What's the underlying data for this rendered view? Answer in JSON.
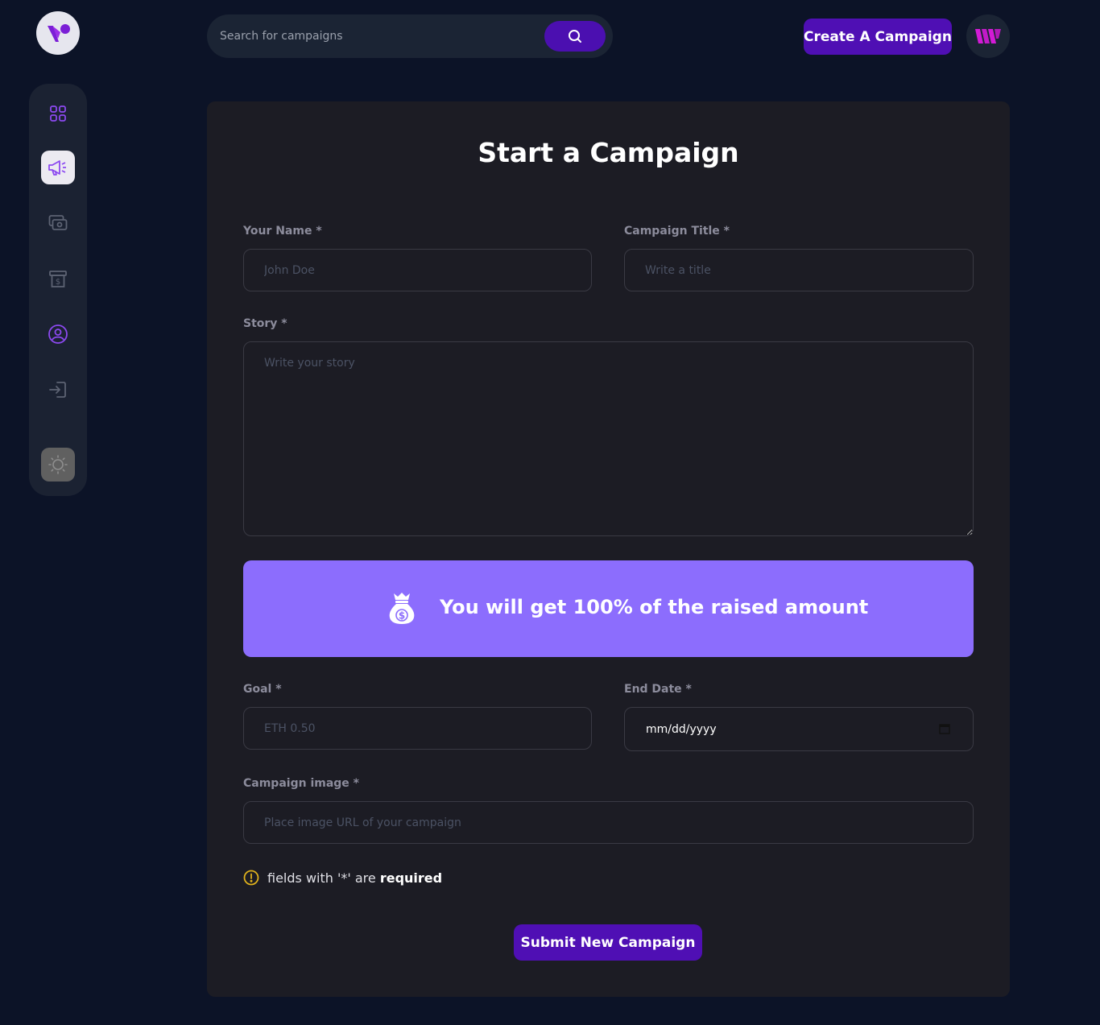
{
  "app": {
    "logo_icon": "v-logo-icon"
  },
  "sidebar": {
    "items": [
      {
        "icon": "dashboard-grid-icon",
        "active": false
      },
      {
        "icon": "megaphone-icon",
        "active": true
      },
      {
        "icon": "payment-icon",
        "active": false
      },
      {
        "icon": "withdraw-icon",
        "active": false
      },
      {
        "icon": "profile-icon",
        "active": false
      },
      {
        "icon": "logout-icon",
        "active": false
      }
    ],
    "theme_toggle_icon": "sun-icon"
  },
  "header": {
    "search_placeholder": "Search for campaigns",
    "search_icon": "search-icon",
    "create_label": "Create A Campaign",
    "avatar_icon": "brand-avatar-icon"
  },
  "form": {
    "title": "Start a Campaign",
    "name_label": "Your Name *",
    "name_placeholder": "John Doe",
    "campaign_title_label": "Campaign Title *",
    "campaign_title_placeholder": "Write a title",
    "story_label": "Story *",
    "story_placeholder": "Write your story",
    "banner_text": "You will get 100% of the raised amount",
    "banner_icon": "money-bag-icon",
    "goal_label": "Goal *",
    "goal_placeholder": "ETH 0.50",
    "end_date_label": "End Date *",
    "end_date_value": "mm/dd/yyyy",
    "image_label": "Campaign image *",
    "image_placeholder": "Place image URL of your campaign",
    "required_note": "fields with '*' are",
    "required_word": "required",
    "submit_label": "Submit New Campaign"
  },
  "colors": {
    "background": "#0c1327",
    "card": "#1c1c24",
    "accent": "#4f0fb4",
    "banner": "#8c6dfd",
    "sidebar_icon": "#8c49f0"
  }
}
